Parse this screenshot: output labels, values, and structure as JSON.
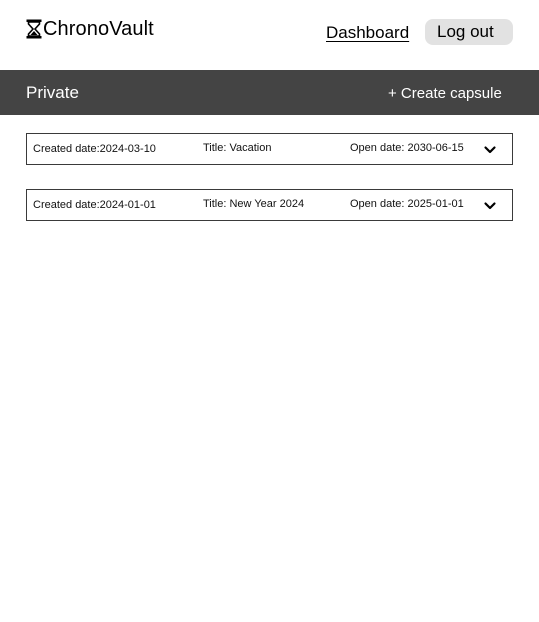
{
  "app": {
    "brand_name": "ChronoVault",
    "brand_icon": "hourglass-icon"
  },
  "nav": {
    "dashboard_label": "Dashboard",
    "logout_label": "Log out"
  },
  "section": {
    "title": "Private",
    "create_label": "+ Create capsule"
  },
  "capsules": [
    {
      "created": "Created date:2024-03-10",
      "title": "Title: Vacation",
      "open": "Open date: 2030-06-15",
      "expand_icon": "chevron-down-icon"
    },
    {
      "created": "Created date:2024-01-01",
      "title": "Title: New Year 2024",
      "open": "Open date: 2025-01-01",
      "expand_icon": "chevron-down-icon"
    }
  ],
  "colors": {
    "header_bar": "#444444",
    "logout_bg": "#e2e2e2",
    "row_border": "#3a3a3a"
  }
}
